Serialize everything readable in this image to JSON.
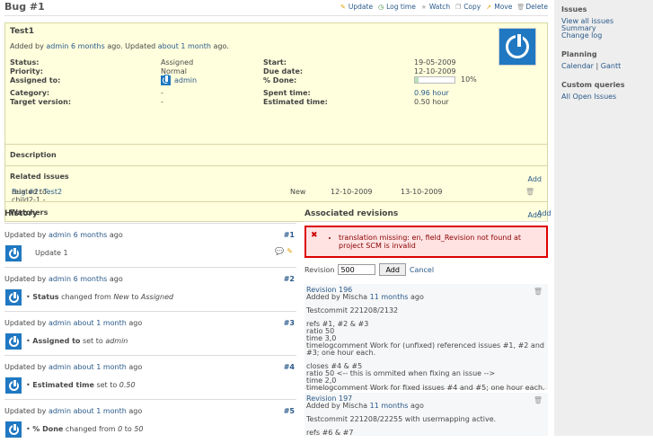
{
  "issue_header": {
    "title": "Bug #1",
    "actions": [
      {
        "label": "Update",
        "icon": "pencil-icon",
        "color": "#e0a000"
      },
      {
        "label": "Log time",
        "icon": "clock-icon",
        "color": "#3a8a3a"
      },
      {
        "label": "Watch",
        "icon": "star-icon",
        "color": "#bbbbbb"
      },
      {
        "label": "Copy",
        "icon": "copy-icon",
        "color": "#888888"
      },
      {
        "label": "Move",
        "icon": "move-icon",
        "color": "#e0a000"
      },
      {
        "label": "Delete",
        "icon": "trash-icon",
        "color": "#999999"
      }
    ]
  },
  "issue": {
    "subject": "Test1",
    "added_by_prefix": "Added by",
    "author": "admin",
    "created_ago": "6 months",
    "ago_mid": "ago. Updated",
    "updated_ago": "about 1 month",
    "ago_end": "ago.",
    "attributes_left": [
      {
        "label": "Status:",
        "value": "Assigned"
      },
      {
        "label": "Priority:",
        "value": "Normal"
      },
      {
        "label": "Assigned to:",
        "value": "admin"
      },
      {
        "label": "Category:",
        "value": "-"
      },
      {
        "label": "Target version:",
        "value": "-"
      }
    ],
    "attributes_right": [
      {
        "label": "Start:",
        "value": "19-05-2009"
      },
      {
        "label": "Due date:",
        "value": "12-10-2009"
      },
      {
        "label": "% Done:",
        "value": "10%"
      },
      {
        "label": "Spent time:",
        "value": "0.96 hour"
      },
      {
        "label": "Estimated time:",
        "value": "0.50 hour"
      }
    ],
    "done_ratio": 0.1,
    "description_label": "Description",
    "related_label": "Related issues",
    "add_label": "Add",
    "relation": {
      "prefix": "related to child2-1 -",
      "link": "Bug #2: Test2",
      "status": "New",
      "start": "12-10-2009",
      "due": "13-10-2009"
    },
    "watchers_label": "Watchers"
  },
  "history": {
    "title": "History",
    "journals": [
      {
        "prefix": "Updated by",
        "author": "admin",
        "ago": "6 months",
        "suffix": "ago",
        "num": "#1",
        "note": "Update 1"
      },
      {
        "prefix": "Updated by",
        "author": "admin",
        "ago": "6 months",
        "suffix": "ago",
        "num": "#2",
        "field": "Status",
        "middle": "changed from",
        "old": "New",
        "to": "to",
        "new": "Assigned"
      },
      {
        "prefix": "Updated by",
        "author": "admin",
        "ago": "about 1 month",
        "suffix": "ago",
        "num": "#3",
        "field": "Assigned to",
        "middle": "set to",
        "new": "admin"
      },
      {
        "prefix": "Updated by",
        "author": "admin",
        "ago": "about 1 month",
        "suffix": "ago",
        "num": "#4",
        "field": "Estimated time",
        "middle": "set to",
        "new": "0.50"
      },
      {
        "prefix": "Updated by",
        "author": "admin",
        "ago": "about 1 month",
        "suffix": "ago",
        "num": "#5",
        "field": "% Done",
        "middle": "changed from",
        "old": "0",
        "to": "to",
        "new": "50"
      }
    ]
  },
  "revisions": {
    "title": "Associated revisions",
    "add_label": "Add",
    "error": "translation missing: en, field_Revision not found at project SCM is invalid",
    "form_label": "Revision",
    "form_value": "500",
    "form_button": "Add",
    "form_cancel": "Cancel",
    "changesets": [
      {
        "revision": "Revision 196",
        "added_prefix": "Added by Mischa",
        "ago": "11 months",
        "ago_suffix": "ago",
        "lines": [
          "Testcommit 221208/2132"
        ],
        "block1": [
          "refs #1, #2 & #3",
          "ratio 50",
          "time 3,0",
          "timelogcomment Work for (unfixed) referenced issues #1, #2 and #3; one hour each."
        ],
        "block2": [
          "closes #4 & #5",
          "ratio 50 <-- this is ommited when fixing an issue -->",
          "time 2,0",
          "timelogcomment Work for fixed issues #4 and #5; one hour each."
        ]
      },
      {
        "revision": "Revision 197",
        "added_prefix": "Added by Mischa",
        "ago": "11 months",
        "ago_suffix": "ago",
        "lines": [
          "Testcommit 221208/22255 with usermapping active."
        ],
        "block1": [
          "refs #6 & #7"
        ]
      }
    ]
  },
  "sidebar": {
    "issues_title": "Issues",
    "issues_links": [
      "View all issues",
      "Summary",
      "Change log"
    ],
    "planning_title": "Planning",
    "calendar": "Calendar",
    "divider": "|",
    "gantt": "Gantt",
    "queries_title": "Custom queries",
    "queries": [
      "All Open Issues"
    ]
  }
}
